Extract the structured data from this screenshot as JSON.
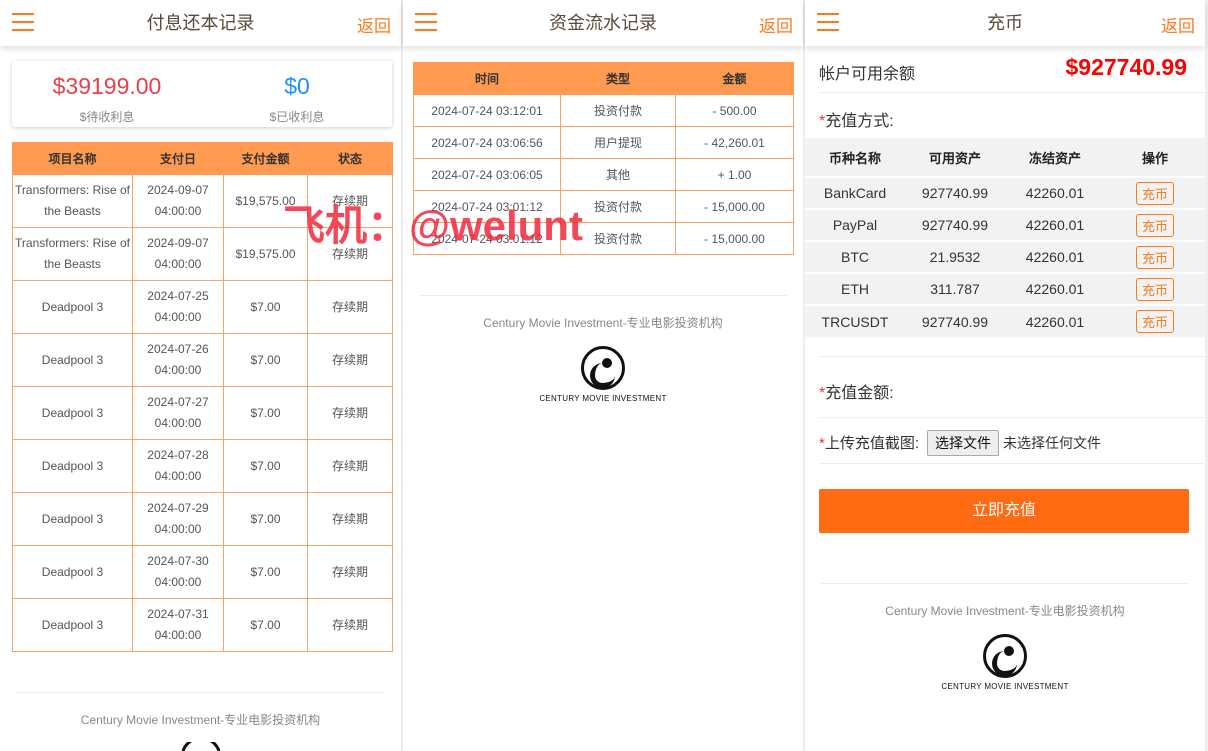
{
  "p1": {
    "title": "付息还本记录",
    "back": "返回",
    "pending_value": "$39199.00",
    "pending_label": "$待收利息",
    "received_value": "$0",
    "received_label": "$已收利息",
    "headers": [
      "项目名称",
      "支付日",
      "支付金额",
      "状态"
    ],
    "rows": [
      [
        "Transformers: Rise of the Beasts",
        "2024-09-07 04:00:00",
        "$19,575.00",
        "存续期"
      ],
      [
        "Transformers: Rise of the Beasts",
        "2024-09-07 04:00:00",
        "$19,575.00",
        "存续期"
      ],
      [
        "Deadpool 3",
        "2024-07-25 04:00:00",
        "$7.00",
        "存续期"
      ],
      [
        "Deadpool 3",
        "2024-07-26 04:00:00",
        "$7.00",
        "存续期"
      ],
      [
        "Deadpool 3",
        "2024-07-27 04:00:00",
        "$7.00",
        "存续期"
      ],
      [
        "Deadpool 3",
        "2024-07-28 04:00:00",
        "$7.00",
        "存续期"
      ],
      [
        "Deadpool 3",
        "2024-07-29 04:00:00",
        "$7.00",
        "存续期"
      ],
      [
        "Deadpool 3",
        "2024-07-30 04:00:00",
        "$7.00",
        "存续期"
      ],
      [
        "Deadpool 3",
        "2024-07-31 04:00:00",
        "$7.00",
        "存续期"
      ]
    ],
    "footer": "Century Movie Investment-专业电影投资机构"
  },
  "p2": {
    "title": "资金流水记录",
    "back": "返回",
    "headers": [
      "时间",
      "类型",
      "金额"
    ],
    "rows": [
      [
        "2024-07-24 03:12:01",
        "投资付款",
        "- 500.00"
      ],
      [
        "2024-07-24 03:06:56",
        "用户提现",
        "- 42,260.01"
      ],
      [
        "2024-07-24 03:06:05",
        "其他",
        "+ 1.00"
      ],
      [
        "2024-07-24 03:01:12",
        "投资付款",
        "- 15,000.00"
      ],
      [
        "2024-07-24 03:01:12",
        "投资付款",
        "- 15,000.00"
      ]
    ],
    "footer": "Century Movie Investment-专业电影投资机构",
    "logo_text": "CENTURY MOVIE INVESTMENT"
  },
  "p3": {
    "title": "充币",
    "back": "返回",
    "balance_label": "帐户可用余额",
    "balance": "$927740.99",
    "method_label": "充值方式:",
    "headers": [
      "币种名称",
      "可用资产",
      "冻结资产",
      "操作"
    ],
    "rows": [
      [
        "BankCard",
        "927740.99",
        "42260.01",
        "充币"
      ],
      [
        "PayPal",
        "927740.99",
        "42260.01",
        "充币"
      ],
      [
        "BTC",
        "21.9532",
        "42260.01",
        "充币"
      ],
      [
        "ETH",
        "311.787",
        "42260.01",
        "充币"
      ],
      [
        "TRCUSDT",
        "927740.99",
        "42260.01",
        "充币"
      ]
    ],
    "amount_label": "充值金额:",
    "upload_label": "上传充值截图:",
    "file_button": "选择文件",
    "file_status": "未选择任何文件",
    "submit": "立即充值",
    "footer": "Century Movie Investment-专业电影投资机构",
    "logo_text": "CENTURY MOVIE INVESTMENT"
  },
  "watermark": "飞机：@welunt",
  "colors": {
    "accent": "#f97a1f",
    "header_bg": "#ff9a50",
    "red": "#e8404a",
    "blue": "#1e90ff"
  }
}
